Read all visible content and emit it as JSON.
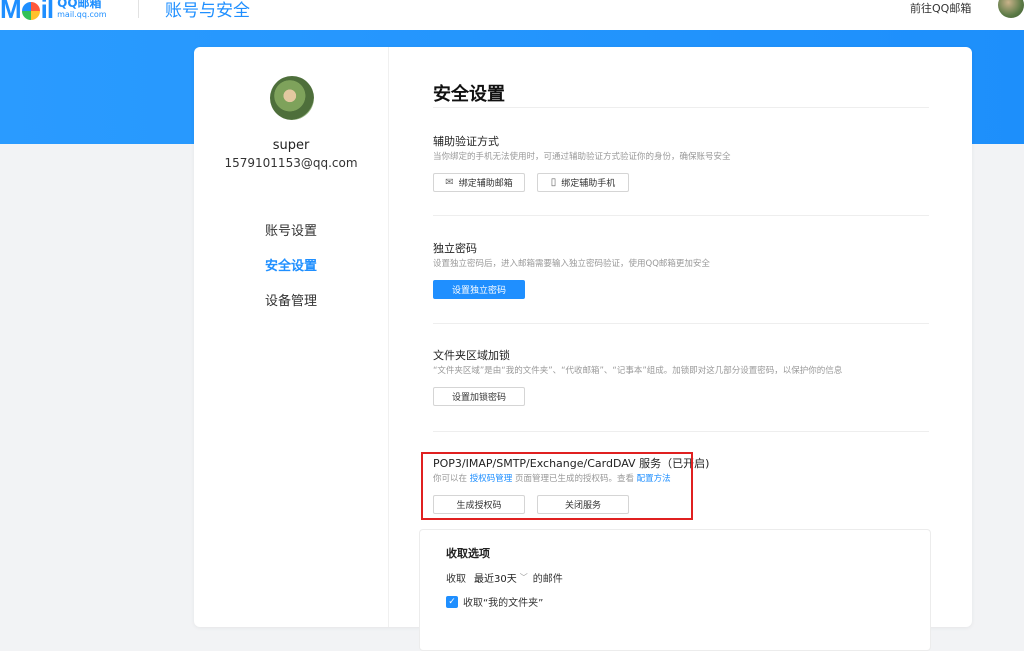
{
  "header": {
    "logo_text": "QQ邮箱",
    "logo_sub": "mail.qq.com",
    "page_heading": "账号与安全",
    "goto_link": "前往QQ邮箱"
  },
  "colors": {
    "accent": "#1f8fff",
    "highlight_border": "#e02020"
  },
  "profile": {
    "username": "super",
    "email": "1579101153@qq.com"
  },
  "nav": {
    "items": [
      "账号设置",
      "安全设置",
      "设备管理"
    ],
    "active": "安全设置"
  },
  "main": {
    "title": "安全设置",
    "aux_verify": {
      "title": "辅助验证方式",
      "desc": "当你绑定的手机无法使用时，可通过辅助验证方式验证你的身份，确保账号安全",
      "bind_email_label": "绑定辅助邮箱",
      "bind_phone_label": "绑定辅助手机",
      "email_icon": "mail-icon",
      "phone_icon": "phone-icon"
    },
    "indep_pwd": {
      "title": "独立密码",
      "desc": "设置独立密码后，进入邮箱需要输入独立密码验证，使用QQ邮箱更加安全",
      "button_label": "设置独立密码"
    },
    "folder_lock": {
      "title": "文件夹区域加锁",
      "desc": "“文件夹区域”是由“我的文件夹”、“代收邮箱”、“记事本”组成。加锁即对这几部分设置密码，以保护你的信息",
      "button_label": "设置加锁密码"
    },
    "pop3": {
      "title": "POP3/IMAP/SMTP/Exchange/CardDAV 服务（已开启)",
      "desc_prefix": "你可以在",
      "desc_link1": "授权码管理",
      "desc_middle": "页面管理已生成的授权码。查看",
      "desc_link2": "配置方法",
      "gen_label": "生成授权码",
      "close_label": "关闭服务"
    },
    "fetch": {
      "title": "收取选项",
      "prefix": "收取",
      "range_value": "最近30天",
      "suffix": "的邮件",
      "checkbox_label": "收取“我的文件夹”",
      "checkbox_checked": true
    }
  }
}
